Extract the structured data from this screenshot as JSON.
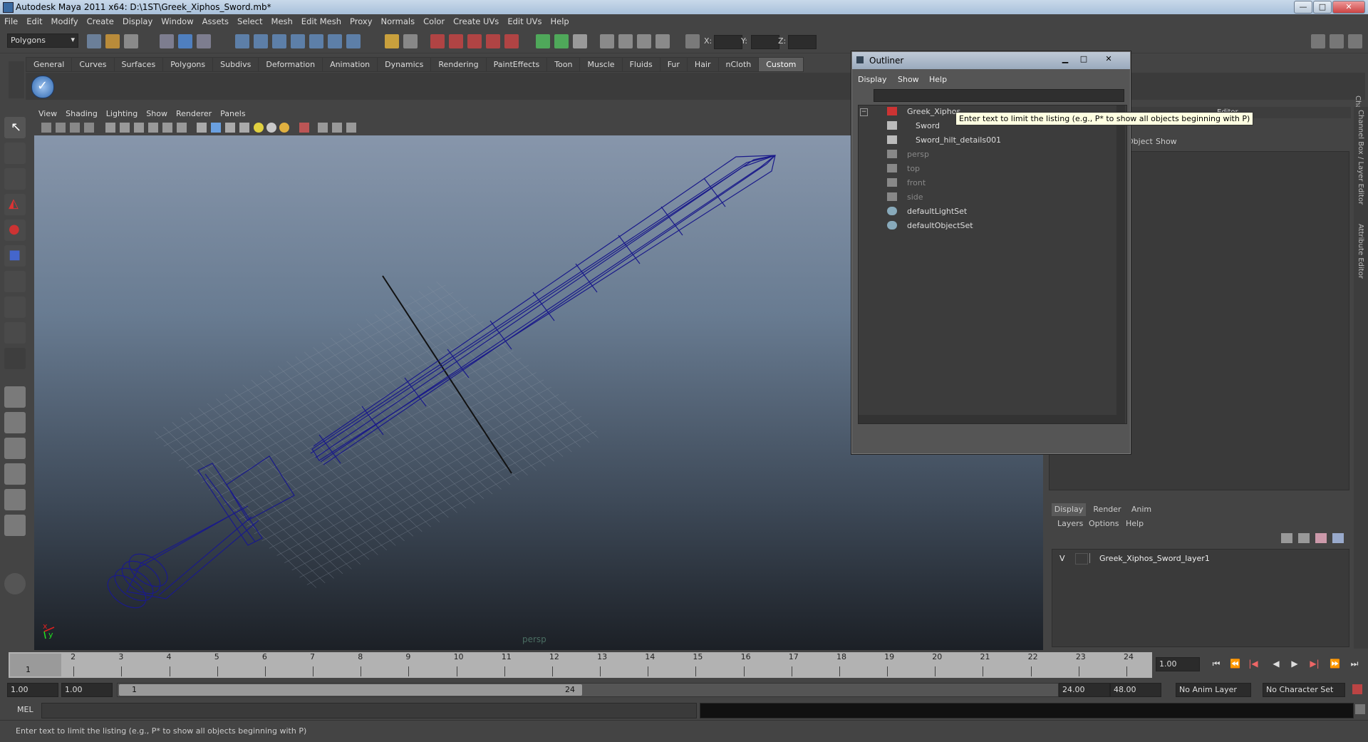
{
  "window": {
    "title": "Autodesk Maya 2011 x64: D:\\1ST\\Greek_Xiphos_Sword.mb*",
    "min": "—",
    "max": "□",
    "close": "✕"
  },
  "menubar": [
    "File",
    "Edit",
    "Modify",
    "Create",
    "Display",
    "Window",
    "Assets",
    "Select",
    "Mesh",
    "Edit Mesh",
    "Proxy",
    "Normals",
    "Color",
    "Create UVs",
    "Edit UVs",
    "Help"
  ],
  "statusline": {
    "mode": "Polygons",
    "x_label": "X:",
    "y_label": "Y:",
    "z_label": "Z:"
  },
  "shelf_tabs": [
    "General",
    "Curves",
    "Surfaces",
    "Polygons",
    "Subdivs",
    "Deformation",
    "Animation",
    "Dynamics",
    "Rendering",
    "PaintEffects",
    "Toon",
    "Muscle",
    "Fluids",
    "Fur",
    "Hair",
    "nCloth",
    "Custom"
  ],
  "shelf_active": "Custom",
  "viewport": {
    "menu": [
      "View",
      "Shading",
      "Lighting",
      "Show",
      "Renderer",
      "Panels"
    ],
    "camera": "persp",
    "axis_x": "x",
    "axis_y": "y"
  },
  "outliner": {
    "title": "Outliner",
    "menu": [
      "Display",
      "Show",
      "Help"
    ],
    "tooltip": "Enter text to limit the listing (e.g., P* to show all objects beginning with P)",
    "items": [
      {
        "label": "Greek_Xiphos",
        "dim": false
      },
      {
        "label": "Sword",
        "dim": false
      },
      {
        "label": "Sword_hilt_details001",
        "dim": false
      },
      {
        "label": "persp",
        "dim": true
      },
      {
        "label": "top",
        "dim": true
      },
      {
        "label": "front",
        "dim": true
      },
      {
        "label": "side",
        "dim": true
      },
      {
        "label": "defaultLightSet",
        "dim": false
      },
      {
        "label": "defaultObjectSet",
        "dim": false
      }
    ]
  },
  "right_panel": {
    "header_title": "Editor",
    "header_menu_obj": "Object",
    "header_menu_show": "Show",
    "side_tab_channel": "Channel Box / Layer Editor",
    "side_tab_attr": "Attribute Editor",
    "layer_tabs": [
      "Display",
      "Render",
      "Anim"
    ],
    "layer_menu": [
      "Layers",
      "Options",
      "Help"
    ],
    "layer": {
      "visibility": "V",
      "name": "Greek_Xiphos_Sword_layer1"
    }
  },
  "timeline": {
    "ticks": [
      "1",
      "2",
      "3",
      "4",
      "5",
      "6",
      "7",
      "8",
      "9",
      "10",
      "11",
      "12",
      "13",
      "14",
      "15",
      "16",
      "17",
      "18",
      "19",
      "20",
      "21",
      "22",
      "23",
      "24"
    ],
    "current": "1",
    "current_field": "1.00"
  },
  "range": {
    "start": "1.00",
    "inner_start": "1.00",
    "slider_start": "1",
    "slider_end": "24",
    "end": "24.00",
    "outer_end": "48.00",
    "anim_layer": "No Anim Layer",
    "char_set": "No Character Set"
  },
  "cmdline": {
    "label": "MEL"
  },
  "helpline": {
    "text": "Enter text to limit the listing (e.g., P* to show all objects beginning with P)"
  }
}
